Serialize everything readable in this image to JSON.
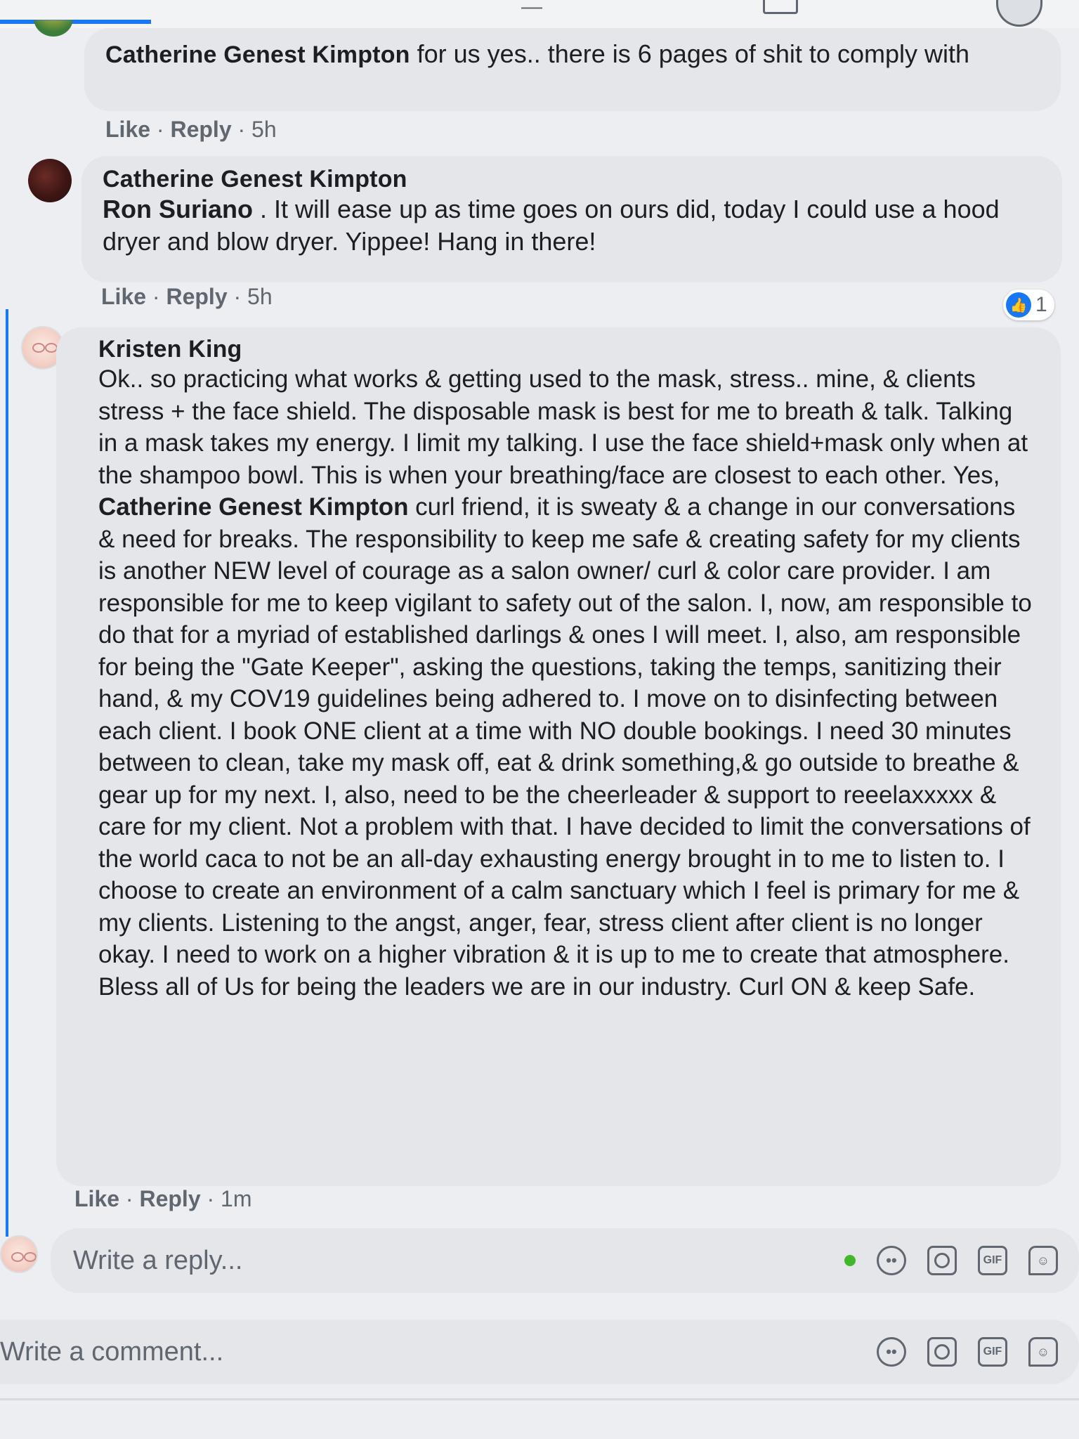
{
  "comments": [
    {
      "author": "Catherine Genest Kimpton",
      "text": " for us yes.. there is 6 pages of shit to comply with",
      "actions": {
        "like": "Like",
        "reply": "Reply",
        "time": "5h"
      }
    },
    {
      "author": "Catherine Genest Kimpton",
      "tag": "Ron Suriano",
      "text": " . It will ease up as time goes on ours did, today I could use a hood dryer and blow dryer. Yippee! Hang in there!",
      "actions": {
        "like": "Like",
        "reply": "Reply",
        "time": "5h"
      },
      "reaction_count": "1"
    },
    {
      "author": "Kristen King",
      "text_before": "Ok.. so practicing what works & getting used to the mask, stress.. mine, & clients stress + the face shield. The disposable mask is best for me to breath & talk. Talking in a mask takes my energy. I limit my talking. I use the face shield+mask only when at the shampoo bowl. This is when your breathing/face are closest to each other. Yes, ",
      "tag": "Catherine Genest Kimpton",
      "text_after": " curl friend, it is sweaty & a change in our conversations & need for breaks. The responsibility to keep me safe & creating safety for my clients is another NEW level of courage as a salon owner/ curl & color care provider. I am responsible for me to keep vigilant to safety out of the salon. I, now, am responsible to do that for a myriad of established darlings & ones I will meet. I, also, am responsible for being the \"Gate Keeper\", asking the questions, taking the temps, sanitizing their hand, & my COV19 guidelines being adhered to. I move on to disinfecting between each client. I book ONE client at a time with NO double bookings. I need 30 minutes between to clean, take my mask off, eat & drink something,& go outside to breathe & gear up for my next. I, also, need to be the cheerleader & support to reeelaxxxxx & care for my client. Not a problem with that. I have decided to limit the conversations of the world caca to not be an all-day exhausting energy brought in to me to listen to. I choose to create an environment of a calm sanctuary which I feel is primary for me & my clients. Listening to the angst, anger, fear, stress client after client is no longer okay. I need to work on a higher vibration & it is up to me to create that atmosphere. Bless all of Us for being the leaders we are in our industry. Curl ON & keep Safe.",
      "actions": {
        "like": "Like",
        "reply": "Reply",
        "time": "1m"
      }
    }
  ],
  "reply_box": {
    "placeholder": "Write a reply..."
  },
  "comment_box": {
    "placeholder": "Write a comment..."
  },
  "toolbar_icons": [
    "emoji-icon",
    "camera-icon",
    "gif-icon",
    "sticker-icon"
  ],
  "tool_labels": {
    "gif": "GIF"
  },
  "colors": {
    "accent": "#1877f2",
    "bubble": "#e4e6ea",
    "online": "#42b72a"
  }
}
